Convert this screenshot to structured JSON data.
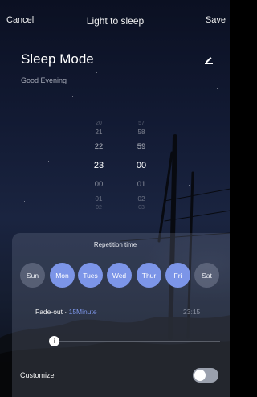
{
  "header": {
    "cancel_label": "Cancel",
    "title": "Light to sleep",
    "save_label": "Save"
  },
  "mode": {
    "title": "Sleep Mode",
    "greeting": "Good Evening",
    "edit_icon": "edit-pencil-icon"
  },
  "picker": {
    "hours": [
      "20",
      "21",
      "22",
      "23",
      "00",
      "01",
      "02"
    ],
    "minutes": [
      "57",
      "58",
      "59",
      "00",
      "01",
      "02",
      "03"
    ],
    "selected": {
      "hour": "23",
      "minute": "00"
    }
  },
  "repetition": {
    "title": "Repetition time",
    "days": [
      {
        "label": "Sun",
        "selected": false
      },
      {
        "label": "Mon",
        "selected": true
      },
      {
        "label": "Tues",
        "selected": true
      },
      {
        "label": "Wed",
        "selected": true
      },
      {
        "label": "Thur",
        "selected": true
      },
      {
        "label": "Fri",
        "selected": true
      },
      {
        "label": "Sat",
        "selected": false
      }
    ]
  },
  "fade": {
    "label": "Fade-out",
    "value": "15Minute",
    "end_time": "23:15",
    "slider_level": 0.0
  },
  "customize": {
    "label": "Customize",
    "enabled": false
  },
  "colors": {
    "accent": "#7c95e8",
    "day_off": "#6e7590",
    "text": "#ffffff",
    "muted": "#a5a9b6"
  }
}
